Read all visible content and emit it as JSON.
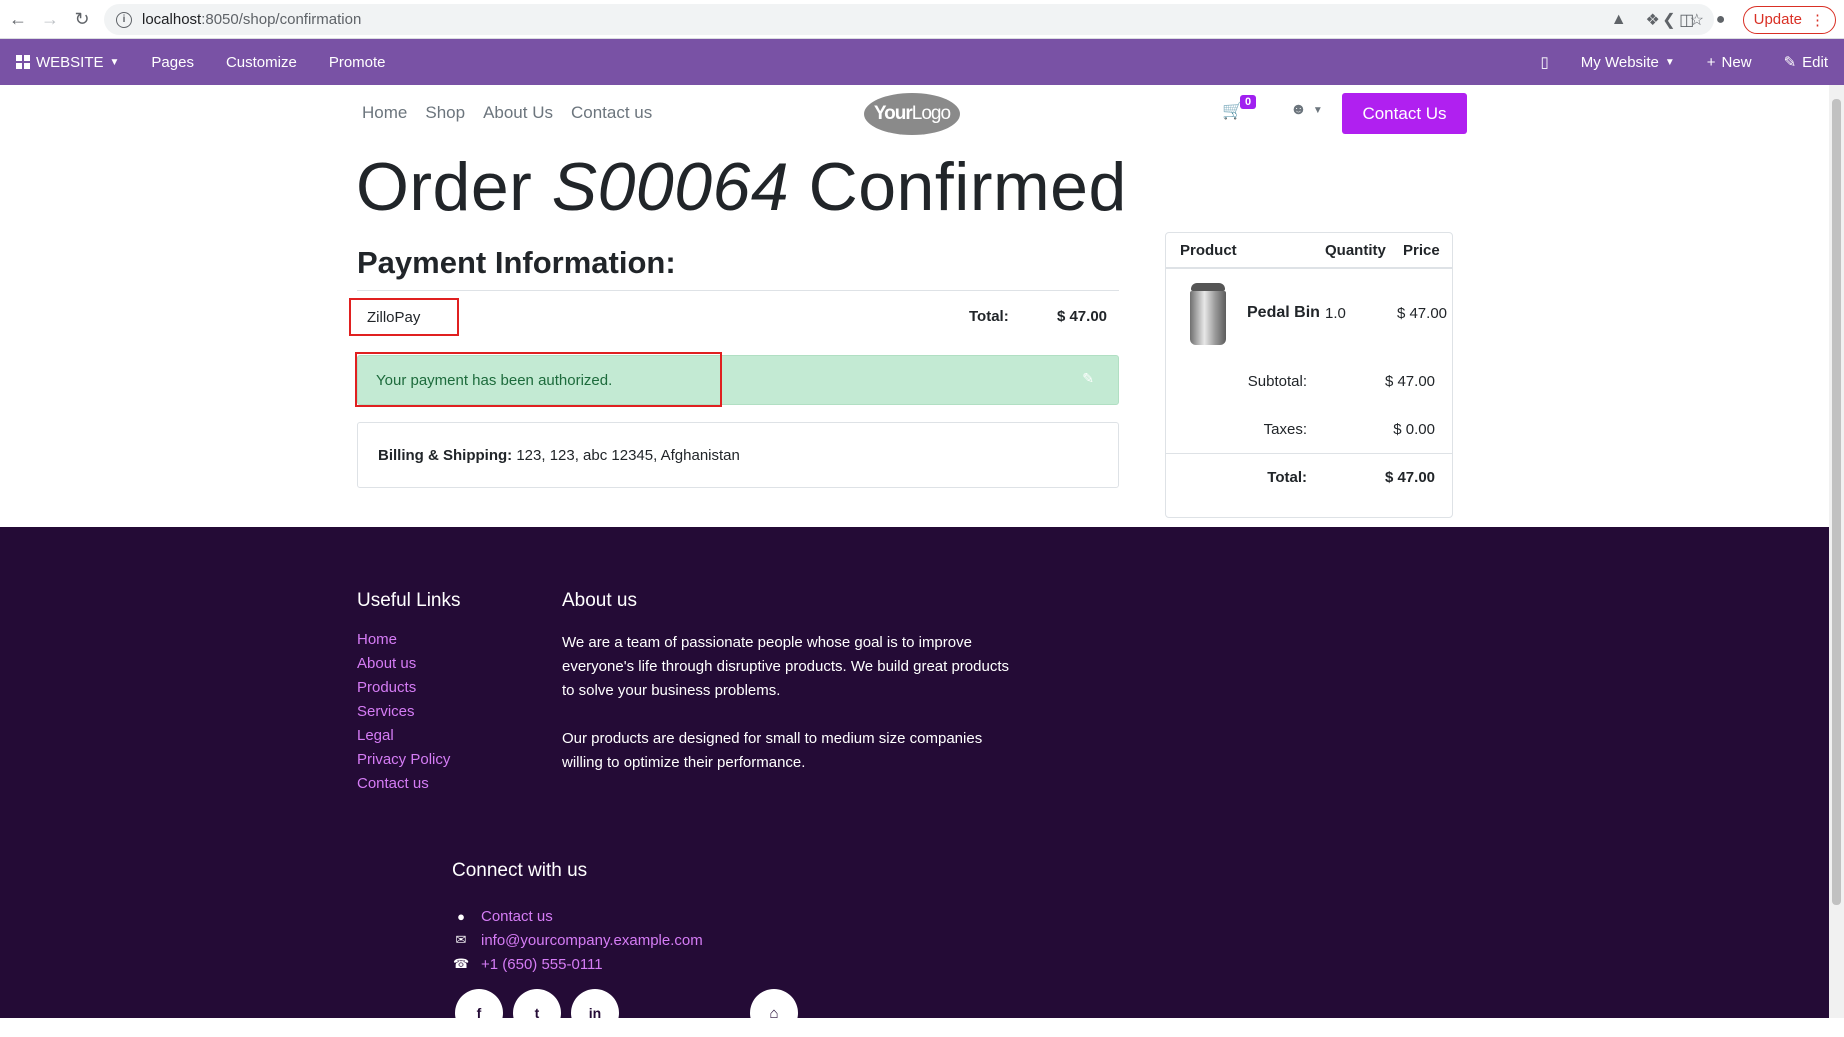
{
  "browser": {
    "url_host": "localhost",
    "url_path": ":8050/shop/confirmation",
    "update_label": "Update"
  },
  "admin_bar": {
    "website_label": "WEBSITE",
    "pages_label": "Pages",
    "customize_label": "Customize",
    "promote_label": "Promote",
    "my_website_label": "My Website",
    "new_label": "New",
    "edit_label": "Edit",
    "color": "#7952a5"
  },
  "header": {
    "nav": [
      "Home",
      "Shop",
      "About Us",
      "Contact us"
    ],
    "logo_bold": "Your",
    "logo_light": "Logo",
    "cart_count": "0",
    "contact_cta": "Contact Us"
  },
  "order": {
    "title_prefix": "Order",
    "order_number": "S00064",
    "title_suffix": "Confirmed",
    "payment_heading": "Payment Information:",
    "provider": "ZilloPay",
    "total_label": "Total:",
    "total_value": "$ 47.00",
    "alert_text": "Your payment has been authorized.",
    "billing_label": "Billing & Shipping:",
    "billing_address": "123, 123, abc 12345, Afghanistan"
  },
  "summary": {
    "columns": [
      "Product",
      "Quantity",
      "Price"
    ],
    "product_name": "Pedal Bin",
    "quantity": "1.0",
    "price": "$ 47.00",
    "subtotal_label": "Subtotal:",
    "subtotal_value": "$ 47.00",
    "taxes_label": "Taxes:",
    "taxes_value": "$ 0.00",
    "total_label": "Total:",
    "total_value": "$ 47.00"
  },
  "footer": {
    "useful_links_title": "Useful Links",
    "useful_links": [
      "Home",
      "About us",
      "Products",
      "Services",
      "Legal",
      "Privacy Policy",
      "Contact us"
    ],
    "about_title": "About us",
    "about_p1": "We are a team of passionate people whose goal is to improve everyone's life through disruptive products. We build great products to solve your business problems.",
    "about_p2": "Our products are designed for small to medium size companies willing to optimize their performance.",
    "connect_title": "Connect with us",
    "contact_link": "Contact us",
    "email": "info@yourcompany.example.com",
    "phone": "+1 (650) 555-0111",
    "social_facebook": "f",
    "social_twitter": "t",
    "social_linkedin": "in",
    "background": "#240b36",
    "link_color": "#d57cf5"
  }
}
